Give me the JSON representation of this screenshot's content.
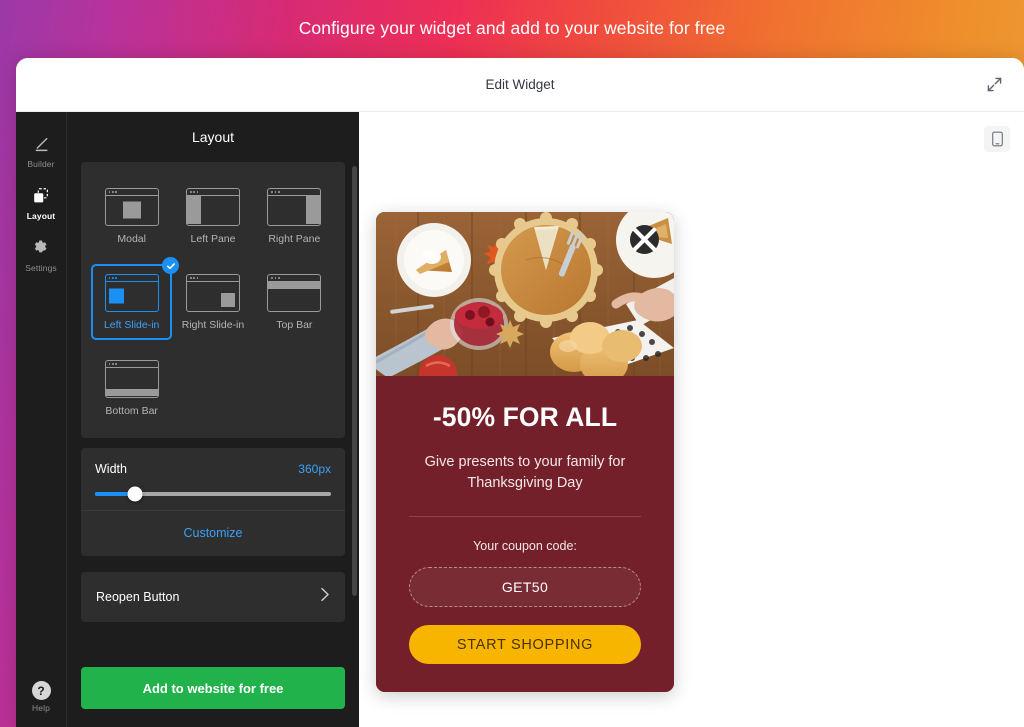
{
  "banner": {
    "text": "Configure your widget and add to your website for free"
  },
  "window": {
    "title": "Edit Widget",
    "expand_icon": "expand-arrows-icon"
  },
  "rail": {
    "items": [
      {
        "label": "Builder",
        "icon": "pencil-icon",
        "active": false
      },
      {
        "label": "Layout",
        "icon": "layout-squares-icon",
        "active": true
      },
      {
        "label": "Settings",
        "icon": "gear-icon",
        "active": false
      }
    ],
    "help": {
      "label": "Help",
      "icon": "question-circle-icon",
      "glyph": "?"
    }
  },
  "panel": {
    "title": "Layout",
    "templates": [
      {
        "label": "Modal",
        "shape": "modal",
        "selected": false
      },
      {
        "label": "Left Pane",
        "shape": "left",
        "selected": false
      },
      {
        "label": "Right Pane",
        "shape": "right",
        "selected": false
      },
      {
        "label": "Left Slide-in",
        "shape": "lslide",
        "selected": true
      },
      {
        "label": "Right Slide-in",
        "shape": "rslide",
        "selected": false
      },
      {
        "label": "Top Bar",
        "shape": "top",
        "selected": false
      },
      {
        "label": "Bottom Bar",
        "shape": "bottom",
        "selected": false
      }
    ],
    "width": {
      "label": "Width",
      "value": "360px",
      "percent": 17
    },
    "customize_label": "Customize",
    "reopen": {
      "label": "Reopen Button",
      "chevron": "chevron-right-icon"
    },
    "cta_label": "Add to website for free"
  },
  "preview": {
    "device_toggle_icon": "mobile-phone-icon",
    "popup": {
      "close_icon": "close-x-icon",
      "image_alt": "thanksgiving-table-photo",
      "headline": "-50% FOR ALL",
      "subtext": "Give presents to your family for Thanksgiving Day",
      "coupon_label": "Your coupon code:",
      "coupon_code": "GET50",
      "cta_label": "START SHOPPING"
    }
  },
  "colors": {
    "accent_blue": "#1a90f5",
    "cta_green": "#22b24c",
    "popup_maroon": "#73202a",
    "popup_button_gold": "#f7b500",
    "panel_dark": "#1d1d1d"
  }
}
